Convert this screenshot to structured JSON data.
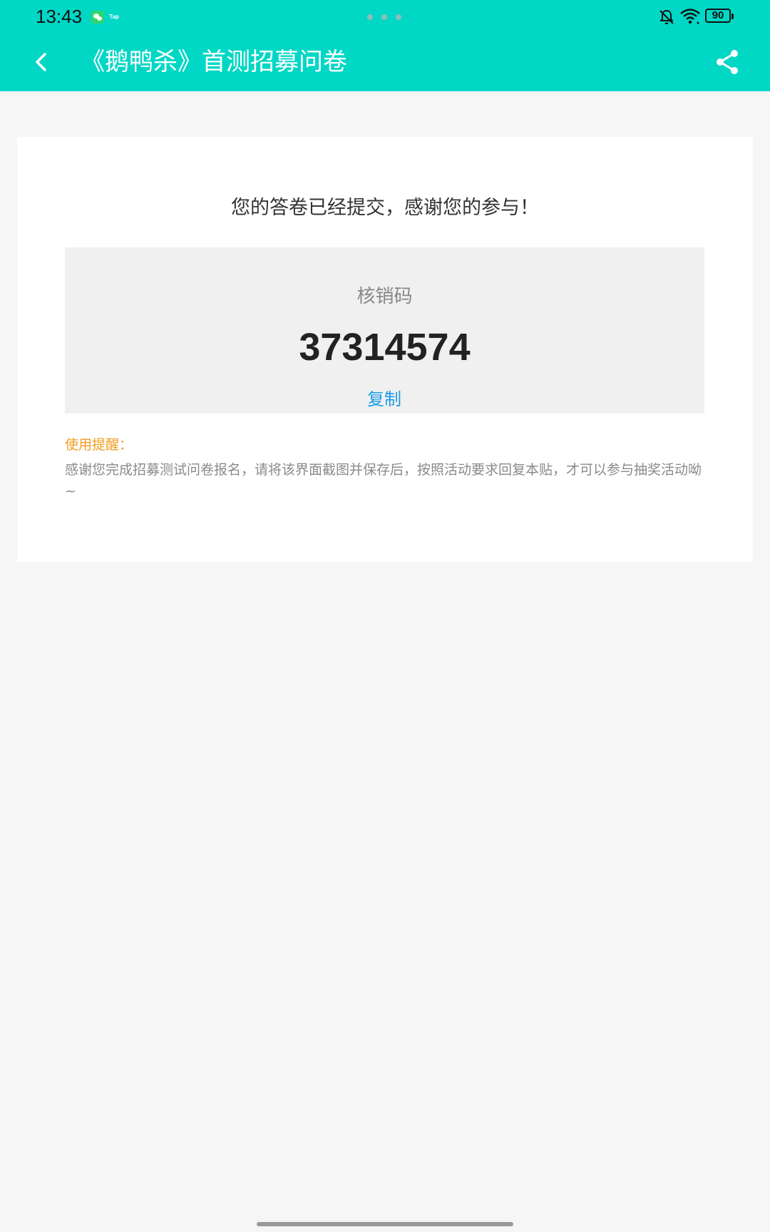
{
  "status_bar": {
    "time": "13:43",
    "tap_label": "Tap",
    "battery": "90",
    "icons": [
      "wechat-icon",
      "tap-icon",
      "bell-off-icon",
      "wifi-icon",
      "battery-icon"
    ]
  },
  "nav": {
    "title": "《鹅鸭杀》首测招募问卷",
    "back_icon": "chevron-left-icon",
    "share_icon": "share-icon"
  },
  "result": {
    "message": "您的答卷已经提交，感谢您的参与！",
    "code_label": "核销码",
    "code_value": "37314574",
    "copy_label": "复制"
  },
  "reminder": {
    "title": "使用提醒：",
    "body": "感谢您完成招募测试问卷报名，请将该界面截图并保存后，按照活动要求回复本贴，才可以参与抽奖活动呦~"
  },
  "colors": {
    "header": "#00d7c5",
    "link": "#1a9be6",
    "reminder_title": "#f39c1f",
    "page_bg": "#f6f6f6"
  }
}
